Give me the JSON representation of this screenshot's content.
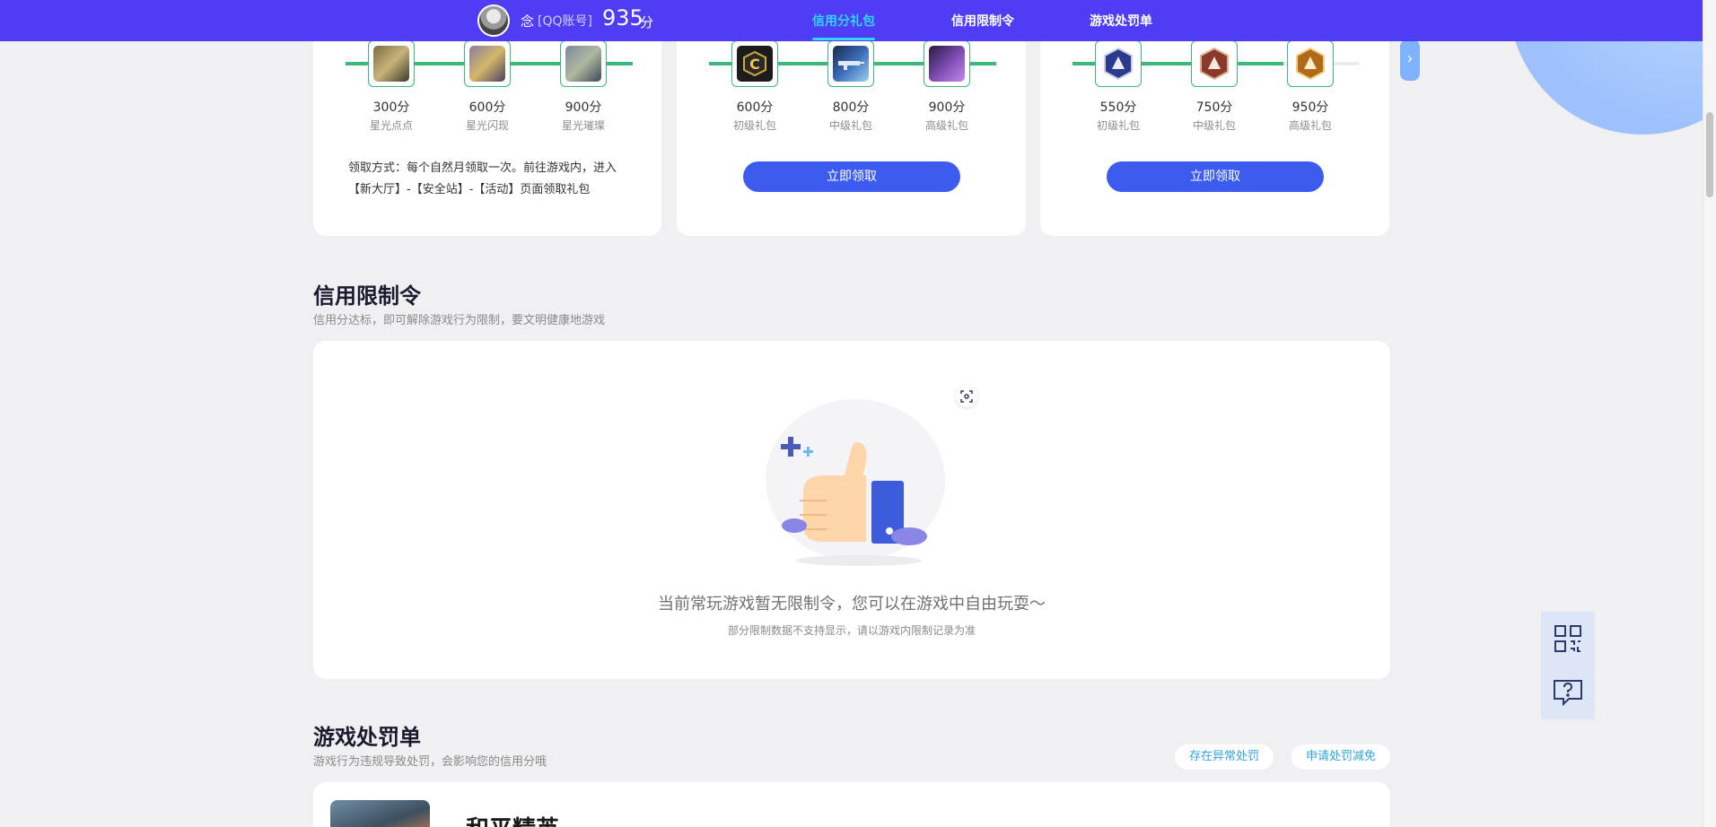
{
  "header": {
    "nickname": "念",
    "account_tag": "[QQ账号]",
    "score": "935",
    "score_unit": "分",
    "nav": [
      {
        "label": "信用分礼包",
        "active": true
      },
      {
        "label": "信用限制令",
        "active": false
      },
      {
        "label": "游戏处罚单",
        "active": false
      }
    ]
  },
  "reward_cards": [
    {
      "items": [
        {
          "score": "300分",
          "name": "星光点点",
          "icon": "starlight-pet-icon"
        },
        {
          "score": "600分",
          "name": "星光闪现",
          "icon": "starlight-pet-icon"
        },
        {
          "score": "900分",
          "name": "星光璀璨",
          "icon": "starlight-pet-icon"
        }
      ],
      "claim_desc": "领取方式：每个自然月领取一次。前往游戏内，进入【新大厅】-【安全站】-【活动】页面领取礼包"
    },
    {
      "items": [
        {
          "score": "600分",
          "name": "初级礼包",
          "icon": "c-badge-icon"
        },
        {
          "score": "800分",
          "name": "中级礼包",
          "icon": "weapon-skin-icon"
        },
        {
          "score": "900分",
          "name": "高级礼包",
          "icon": "vehicle-skin-icon"
        }
      ],
      "button": "立即领取"
    },
    {
      "items": [
        {
          "score": "550分",
          "name": "初级礼包",
          "icon": "rank-badge-icon"
        },
        {
          "score": "750分",
          "name": "中级礼包",
          "icon": "rank-badge-icon"
        },
        {
          "score": "950分",
          "name": "高级礼包",
          "icon": "rank-badge-icon"
        }
      ],
      "button": "立即领取"
    }
  ],
  "restriction": {
    "title": "信用限制令",
    "subtitle": "信用分达标，即可解除游戏行为限制，要文明健康地游戏",
    "empty_text": "当前常玩游戏暂无限制令，您可以在游戏中自由玩耍～",
    "empty_note": "部分限制数据不支持显示，请以游戏内限制记录为准"
  },
  "penalty": {
    "title": "游戏处罚单",
    "subtitle": "游戏行为违规导致处罚，会影响您的信用分哦",
    "pill_abnormal": "存在异常处罚",
    "pill_reduce": "申请处罚减免",
    "game_name": "和平精英"
  },
  "colors": {
    "header_bg": "#4f3cf5",
    "nav_active": "#2fd6ff",
    "track": "#3cb878",
    "primary_button": "#3c5cf0",
    "page_bg": "#f0f0f2"
  }
}
